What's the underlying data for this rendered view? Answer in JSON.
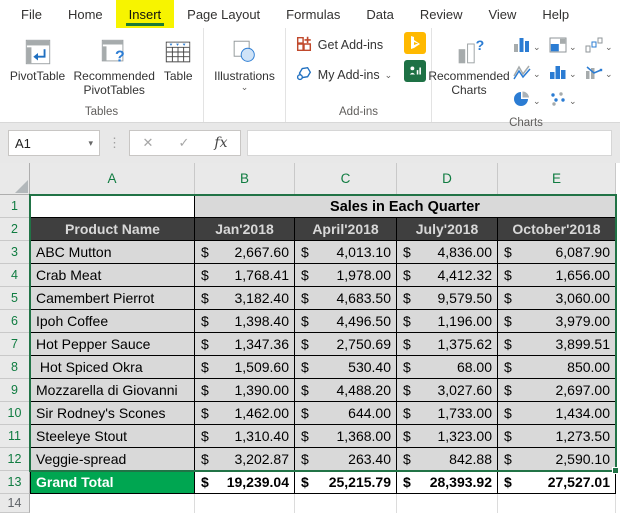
{
  "tabs": {
    "items": [
      "File",
      "Home",
      "Insert",
      "Page Layout",
      "Formulas",
      "Data",
      "Review",
      "View",
      "Help"
    ],
    "active": "Insert"
  },
  "ribbon": {
    "tables": {
      "label": "Tables",
      "pivottable": "PivotTable",
      "recommended_pivottables": "Recommended PivotTables",
      "table": "Table"
    },
    "illustrations": {
      "button": "Illustrations"
    },
    "addins": {
      "label": "Add-ins",
      "get_addins": "Get Add-ins",
      "my_addins": "My Add-ins",
      "bing_icon": "bing-maps-addin-icon",
      "people_icon": "people-graph-addin-icon"
    },
    "charts": {
      "label": "Charts",
      "recommended_charts": "Recommended Charts",
      "mini_icons": [
        "column-chart",
        "hierarchy-chart",
        "waterfall-chart",
        "line-chart",
        "histogram-chart",
        "combo-chart",
        "pie-chart",
        "scatter-chart"
      ]
    }
  },
  "formula_bar": {
    "name_box": "A1",
    "fx": "fx",
    "value": ""
  },
  "sheet": {
    "col_headers": [
      "A",
      "B",
      "C",
      "D",
      "E"
    ],
    "row_headers": [
      "1",
      "2",
      "3",
      "4",
      "5",
      "6",
      "7",
      "8",
      "9",
      "10",
      "11",
      "12",
      "13",
      "14"
    ],
    "currency_symbol": "$",
    "title": "Sales in Each Quarter",
    "table_header": [
      "Product Name",
      "Jan'2018",
      "April'2018",
      "July'2018",
      "October'2018"
    ],
    "rows": [
      {
        "name": "ABC Mutton",
        "values": [
          "2,667.60",
          "4,013.10",
          "4,836.00",
          "6,087.90"
        ]
      },
      {
        "name": "Crab Meat",
        "values": [
          "1,768.41",
          "1,978.00",
          "4,412.32",
          "1,656.00"
        ]
      },
      {
        "name": "Camembert Pierrot",
        "values": [
          "3,182.40",
          "4,683.50",
          "9,579.50",
          "3,060.00"
        ]
      },
      {
        "name": "Ipoh Coffee",
        "values": [
          "1,398.40",
          "4,496.50",
          "1,196.00",
          "3,979.00"
        ]
      },
      {
        "name": "Hot Pepper Sauce",
        "values": [
          "1,347.36",
          "2,750.69",
          "1,375.62",
          "3,899.51"
        ]
      },
      {
        "name": " Hot Spiced Okra",
        "values": [
          "1,509.60",
          "530.40",
          "68.00",
          "850.00"
        ]
      },
      {
        "name": "Mozzarella di Giovanni",
        "values": [
          "1,390.00",
          "4,488.20",
          "3,027.60",
          "2,697.00"
        ]
      },
      {
        "name": "Sir Rodney's Scones",
        "values": [
          "1,462.00",
          "644.00",
          "1,733.00",
          "1,434.00"
        ]
      },
      {
        "name": "Steeleye Stout",
        "values": [
          "1,310.40",
          "1,368.00",
          "1,323.00",
          "1,273.50"
        ]
      },
      {
        "name": "Veggie-spread",
        "values": [
          "3,202.87",
          "263.40",
          "842.88",
          "2,590.10"
        ]
      }
    ],
    "grand_total": {
      "label": "Grand Total",
      "values": [
        "19,239.04",
        "25,215.79",
        "28,393.92",
        "27,527.01"
      ]
    }
  },
  "colors": {
    "accent_green": "#217346",
    "header_text_green": "#107c41",
    "grand_total_green": "#00a651",
    "cell_gray": "#d9d9d9",
    "header_dark_gray": "#3f3f3f",
    "tab_highlight_yellow": "#f7f400",
    "chart_icon_blue": "#2b7cd3"
  }
}
